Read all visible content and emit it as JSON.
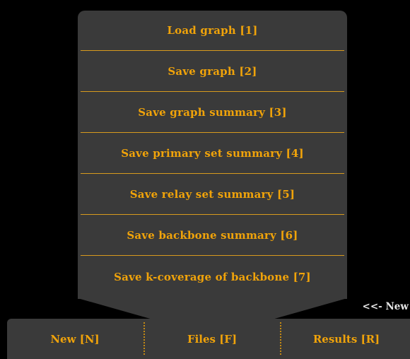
{
  "menu": {
    "items": [
      {
        "label": "Load graph [1]"
      },
      {
        "label": "Save graph [2]"
      },
      {
        "label": "Save graph summary [3]"
      },
      {
        "label": "Save primary set summary [4]"
      },
      {
        "label": "Save relay set summary [5]"
      },
      {
        "label": "Save backbone summary [6]"
      },
      {
        "label": "Save k-coverage of backbone [7]"
      }
    ]
  },
  "hint": {
    "text": "<<- New"
  },
  "tabbar": {
    "tabs": [
      {
        "label": "New [N]"
      },
      {
        "label": "Files [F]"
      },
      {
        "label": "Results [R]"
      }
    ]
  },
  "colors": {
    "accent": "#f0a30a",
    "panel": "#3a3a3a",
    "background": "#000000",
    "hint_text": "#e6e6e6"
  }
}
